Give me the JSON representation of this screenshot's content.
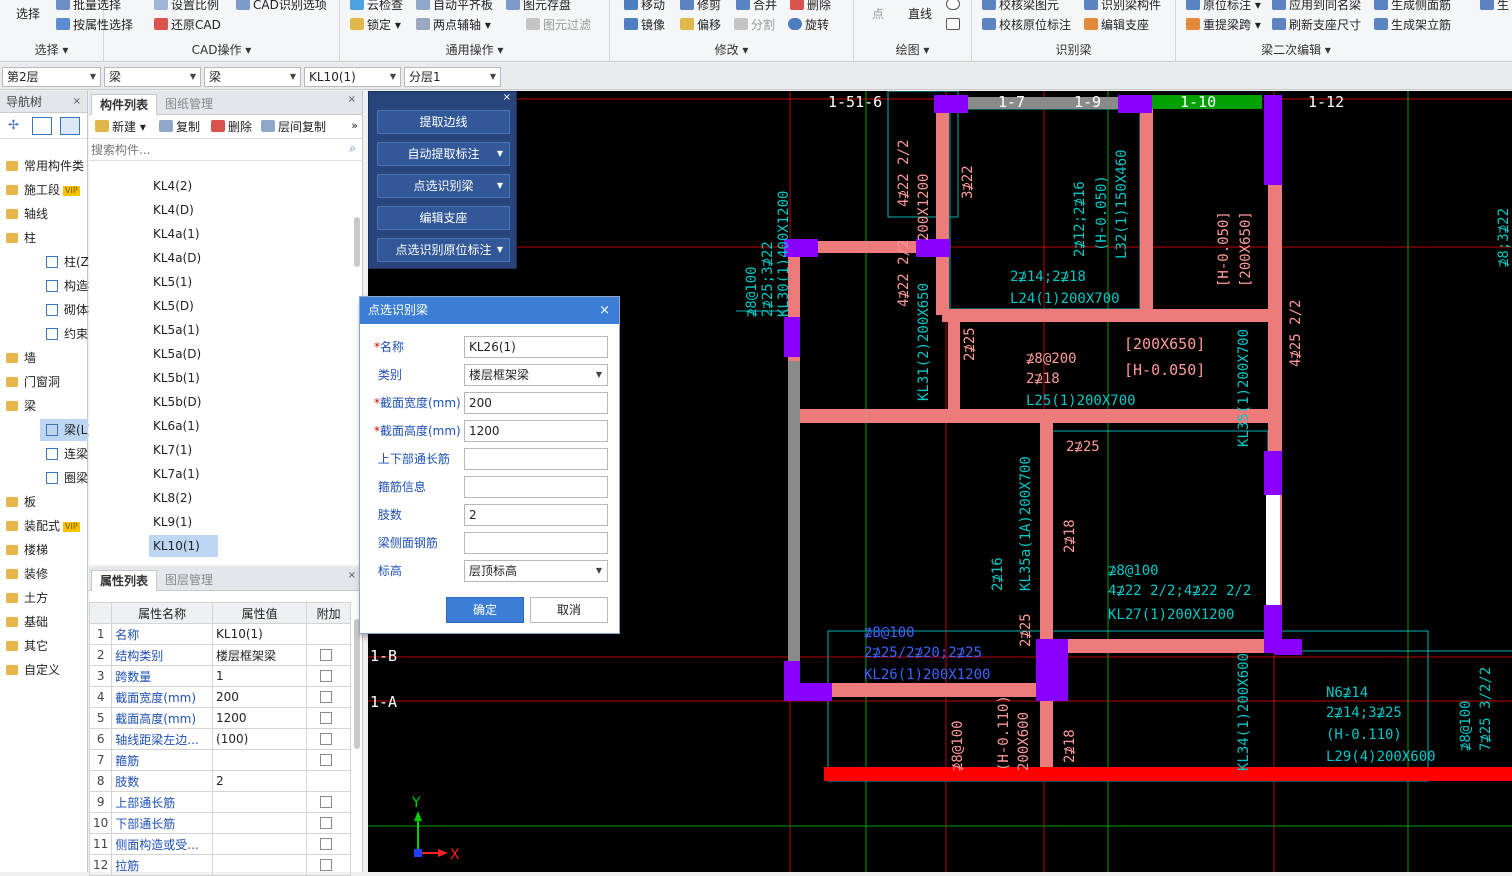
{
  "ribbon": {
    "groups": [
      {
        "label": "选择 ▾",
        "items": [
          "选择",
          "批量选择",
          "按属性选择"
        ]
      },
      {
        "label": "CAD操作 ▾",
        "items": [
          "设置比例",
          "CAD识别选项",
          "还原CAD"
        ]
      },
      {
        "label": "通用操作 ▾",
        "items": [
          "云检查",
          "自动平齐板",
          "图元存盘",
          "锁定 ▾",
          "两点辅轴 ▾",
          "图元过滤"
        ]
      },
      {
        "label": "修改 ▾",
        "items": [
          "移动",
          "修剪",
          "合并",
          "删除",
          "镜像",
          "偏移",
          "分割",
          "旋转"
        ]
      },
      {
        "label": "绘图 ▾",
        "items": [
          "点",
          "直线"
        ]
      },
      {
        "label": "识别梁",
        "items": [
          "校核梁图元",
          "识别梁构件",
          "校核原位标注",
          "编辑支座"
        ]
      },
      {
        "label": "梁二次编辑 ▾",
        "items": [
          "原位标注 ▾",
          "应用到同名梁",
          "生成侧面筋",
          "重提梁跨 ▾",
          "刷新支座尺寸",
          "生成架立筋",
          "生"
        ]
      }
    ]
  },
  "toolbar2": {
    "combos": [
      "第2层",
      "梁",
      "梁",
      "KL10(1)",
      "分层1"
    ]
  },
  "nav": {
    "title": "导航树",
    "items": [
      {
        "label": "常用构件类",
        "type": "folder"
      },
      {
        "label": "施工段",
        "type": "folder",
        "badge": "VIP"
      },
      {
        "label": "轴线",
        "type": "folder"
      },
      {
        "label": "柱",
        "type": "folder"
      },
      {
        "label": "柱(Z)",
        "type": "sub"
      },
      {
        "label": "构造柱",
        "type": "sub"
      },
      {
        "label": "砌体柱",
        "type": "sub"
      },
      {
        "label": "约束",
        "type": "sub"
      },
      {
        "label": "墙",
        "type": "folder"
      },
      {
        "label": "门窗洞",
        "type": "folder"
      },
      {
        "label": "梁",
        "type": "folder"
      },
      {
        "label": "梁(L)",
        "type": "sub",
        "selected": true
      },
      {
        "label": "连梁",
        "type": "sub"
      },
      {
        "label": "圈梁",
        "type": "sub"
      },
      {
        "label": "板",
        "type": "folder"
      },
      {
        "label": "装配式",
        "type": "folder",
        "badge": "VIP"
      },
      {
        "label": "楼梯",
        "type": "folder"
      },
      {
        "label": "装修",
        "type": "folder"
      },
      {
        "label": "土方",
        "type": "folder"
      },
      {
        "label": "基础",
        "type": "folder"
      },
      {
        "label": "其它",
        "type": "folder"
      },
      {
        "label": "自定义",
        "type": "folder"
      }
    ]
  },
  "component_list": {
    "tabs": [
      "构件列表",
      "图纸管理"
    ],
    "toolbar": [
      "新建 ▾",
      "复制",
      "删除",
      "层间复制"
    ],
    "search_placeholder": "搜索构件...",
    "items": [
      "KL4(2)",
      "KL4(D)",
      "KL4a(1)",
      "KL4a(D)",
      "KL5(1)",
      "KL5(D)",
      "KL5a(1)",
      "KL5a(D)",
      "KL5b(1)",
      "KL5b(D)",
      "KL6a(1)",
      "KL7(1)",
      "KL7a(1)",
      "KL8(2)",
      "KL9(1)",
      "KL10(1)"
    ],
    "selected": "KL10(1)"
  },
  "properties": {
    "tabs": [
      "属性列表",
      "图层管理"
    ],
    "headers": [
      "属性名称",
      "属性值",
      "附加"
    ],
    "rows": [
      {
        "n": "1",
        "name": "名称",
        "value": "KL10(1)",
        "chk": false
      },
      {
        "n": "2",
        "name": "结构类别",
        "value": "楼层框架梁",
        "chk": true
      },
      {
        "n": "3",
        "name": "跨数量",
        "value": "1",
        "chk": true
      },
      {
        "n": "4",
        "name": "截面宽度(mm)",
        "value": "200",
        "chk": true
      },
      {
        "n": "5",
        "name": "截面高度(mm)",
        "value": "1200",
        "chk": true
      },
      {
        "n": "6",
        "name": "轴线距梁左边...",
        "value": "(100)",
        "chk": true
      },
      {
        "n": "7",
        "name": "箍筋",
        "value": "",
        "chk": true
      },
      {
        "n": "8",
        "name": "肢数",
        "value": "2",
        "chk": false
      },
      {
        "n": "9",
        "name": "上部通长筋",
        "value": "",
        "chk": true
      },
      {
        "n": "10",
        "name": "下部通长筋",
        "value": "",
        "chk": true
      },
      {
        "n": "11",
        "name": "侧面构造或受...",
        "value": "",
        "chk": true
      },
      {
        "n": "12",
        "name": "拉筋",
        "value": "",
        "chk": true
      }
    ]
  },
  "tool_panel": {
    "buttons": [
      {
        "label": "提取边线",
        "dd": false
      },
      {
        "label": "自动提取标注",
        "dd": true
      },
      {
        "label": "点选识别梁",
        "dd": true
      },
      {
        "label": "编辑支座",
        "dd": false
      },
      {
        "label": "点选识别原位标注",
        "dd": true
      }
    ]
  },
  "dialog": {
    "title": "点选识别梁",
    "fields": [
      {
        "label": "名称",
        "req": true,
        "value": "KL26(1)",
        "select": false
      },
      {
        "label": "类别",
        "req": false,
        "value": "楼层框架梁",
        "select": true
      },
      {
        "label": "截面宽度(mm)",
        "req": true,
        "value": "200",
        "select": false
      },
      {
        "label": "截面高度(mm)",
        "req": true,
        "value": "1200",
        "select": false
      },
      {
        "label": "上下部通长筋",
        "req": false,
        "value": "",
        "select": false
      },
      {
        "label": "箍筋信息",
        "req": false,
        "value": "",
        "select": false
      },
      {
        "label": "肢数",
        "req": false,
        "value": "2",
        "select": false
      },
      {
        "label": "梁侧面钢筋",
        "req": false,
        "value": "",
        "select": false
      },
      {
        "label": "标高",
        "req": false,
        "value": "层顶标高",
        "select": true
      }
    ],
    "ok_label": "确定",
    "cancel_label": "取消"
  },
  "cad": {
    "axis_labels": {
      "a1": "1-51-6",
      "a2": "1-7",
      "a3": "1-9",
      "a4": "1-10",
      "a5": "1-12",
      "b1": "1-B",
      "b2": "1-A"
    },
    "annotations": {
      "t1": "4⊉22 2/2",
      "t2": "200X1200",
      "t3": "3⊉22",
      "t4": "2⊉12;2⊉16",
      "t5": "(H-0.050)",
      "t6": "L32(1)150X460",
      "t7": "[H-0.050]",
      "t8": "[200X650]",
      "t9": "2⊉14;2⊉18",
      "t10": "L24(1)200X700",
      "t11": "⊉8@100",
      "t12": "2⊉25;3⊉22",
      "t13": "KL30(1)400X1200",
      "t14": "4⊉22 2/2",
      "t15": "KL31(2)200X650",
      "t16": "2⊉25",
      "t17": "⊉8@200",
      "t18": "2⊉18",
      "t19": "L25(1)200X700",
      "t20": "[200X650]",
      "t21": "[H-0.050]",
      "t22": "4⊉25 2/2",
      "t23": "KL35(1)200X700",
      "t24": "2⊉25",
      "t25": "2⊉16",
      "t26": "KL35a(1A)200X700",
      "t27": "2⊉18",
      "t28": "⊉8@100",
      "t29": "4⊉22 2/2;4⊉22 2/2",
      "t30": "KL27(1)200X1200",
      "t31": "⊉8@100",
      "t32": "2⊉25/2⊉20;2⊉25",
      "t33": "KL26(1)200X1200",
      "t34": "2⊉25",
      "t35": "⊉8@100",
      "t36": "(H-0.110)",
      "t37": "200X600",
      "t38": "2⊉18",
      "t39": "KL34(1)200X600",
      "t40": "N6⊉14",
      "t41": "2⊉14;3⊉25",
      "t42": "(H-0.110)",
      "t43": "L29(4)200X600",
      "t44": "⊉8@100",
      "t45": "7⊉25 3/2/2",
      "t46": "⊉8;3⊉22",
      "t47": "X",
      "t48": "Y"
    }
  }
}
